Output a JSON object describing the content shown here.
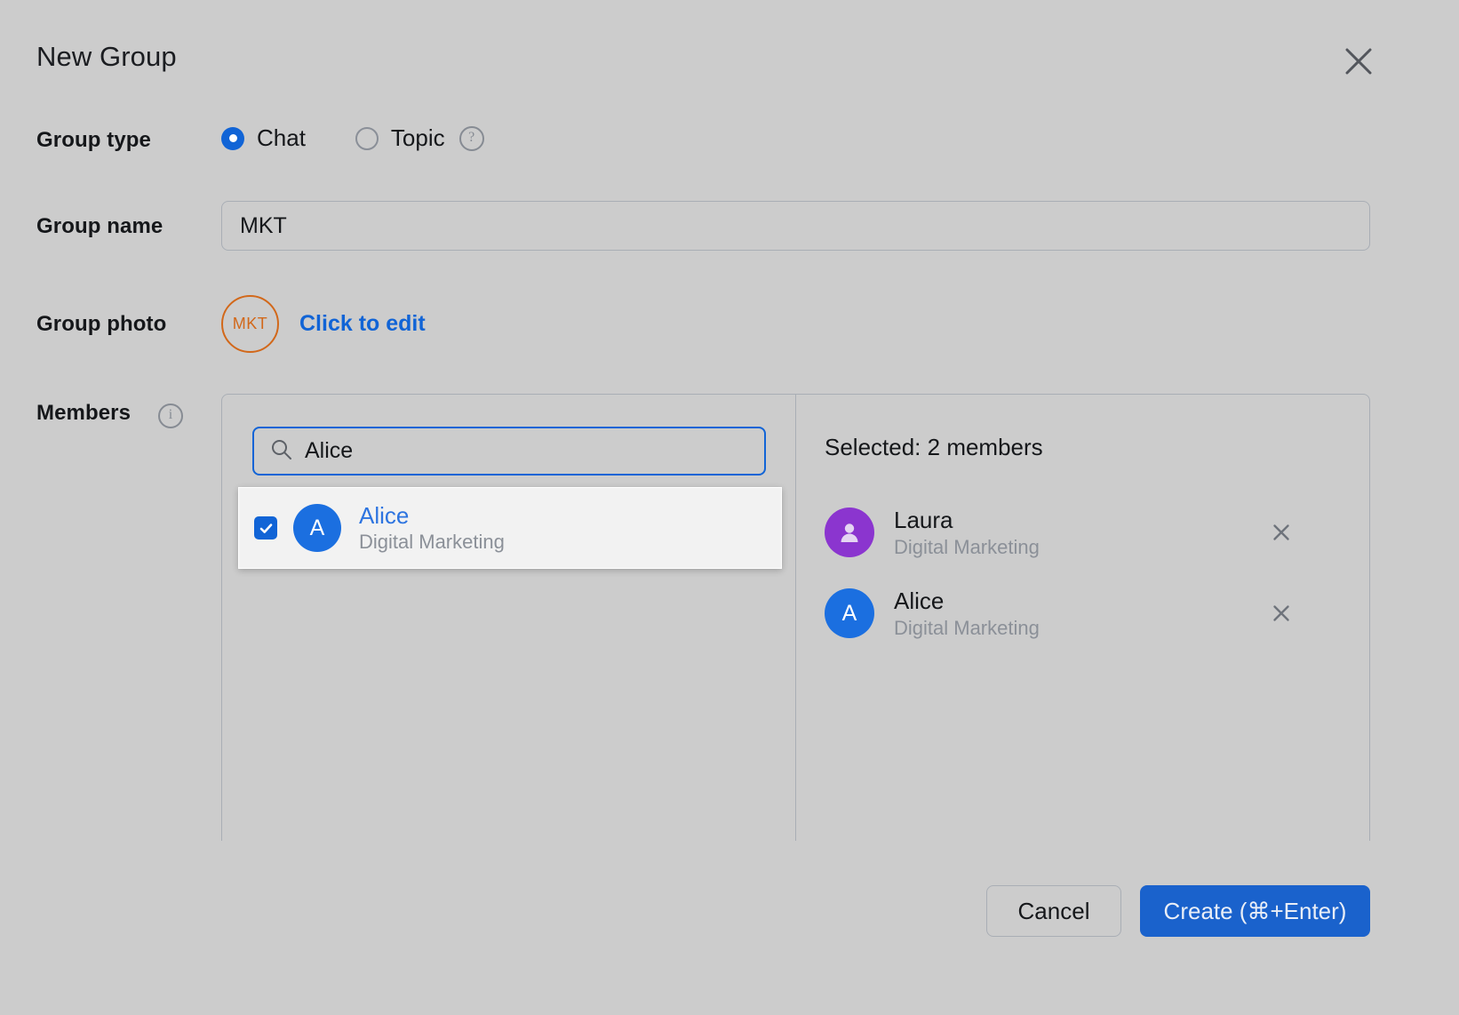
{
  "dialog": {
    "title": "New Group",
    "close_icon": "close-icon"
  },
  "group_type": {
    "label": "Group type",
    "options": [
      {
        "label": "Chat",
        "selected": true
      },
      {
        "label": "Topic",
        "selected": false
      }
    ],
    "help_icon_char": "?"
  },
  "group_name": {
    "label": "Group name",
    "value": "MKT",
    "placeholder": "Group name"
  },
  "group_photo": {
    "label": "Group photo",
    "initials": "MKT",
    "edit_link": "Click to edit",
    "border_color": "#d2681a"
  },
  "members": {
    "label": "Members",
    "info_icon_char": "i",
    "search": {
      "value": "Alice",
      "placeholder": "Search members",
      "icon": "search-icon"
    },
    "results": [
      {
        "name": "Alice",
        "department": "Digital Marketing",
        "initial": "A",
        "avatar_color": "#1b6fe0",
        "checked": true
      }
    ],
    "selected_title": "Selected: 2 members",
    "selected": [
      {
        "name": "Laura",
        "department": "Digital Marketing",
        "initial": "",
        "avatar_color": "#8b35cf",
        "avatar_icon": "person-icon",
        "remove_icon": "close-icon"
      },
      {
        "name": "Alice",
        "department": "Digital Marketing",
        "initial": "A",
        "avatar_color": "#1b6fe0",
        "avatar_icon": "",
        "remove_icon": "close-icon"
      }
    ]
  },
  "footer": {
    "cancel_label": "Cancel",
    "create_label": "Create (⌘+Enter)",
    "accent_color": "#1a62cc"
  }
}
